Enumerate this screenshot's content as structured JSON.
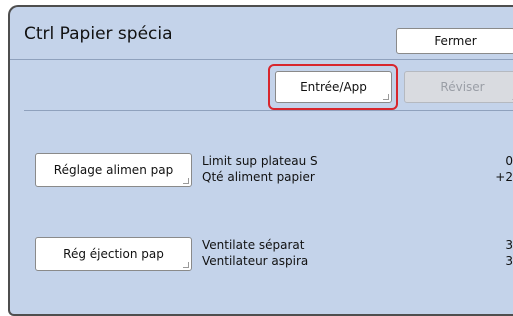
{
  "window": {
    "title": "Ctrl Papier spécia"
  },
  "toolbar": {
    "close_label": "Fermer",
    "entry_label": "Entrée/App",
    "revise_label": "Réviser"
  },
  "sections": [
    {
      "button_label": "Réglage alimen pap",
      "params": [
        {
          "label": "Limit sup plateau S",
          "value": "0"
        },
        {
          "label": "Qté aliment papier",
          "value": "+2"
        }
      ]
    },
    {
      "button_label": "Rég éjection pap",
      "params": [
        {
          "label": "Ventilate séparat",
          "value": "3"
        },
        {
          "label": "Ventilateur aspira",
          "value": "3"
        }
      ]
    }
  ],
  "colors": {
    "panel_background": "#c4d3ea",
    "highlight": "#d8262d",
    "disabled_button": "#d9dbe0"
  }
}
